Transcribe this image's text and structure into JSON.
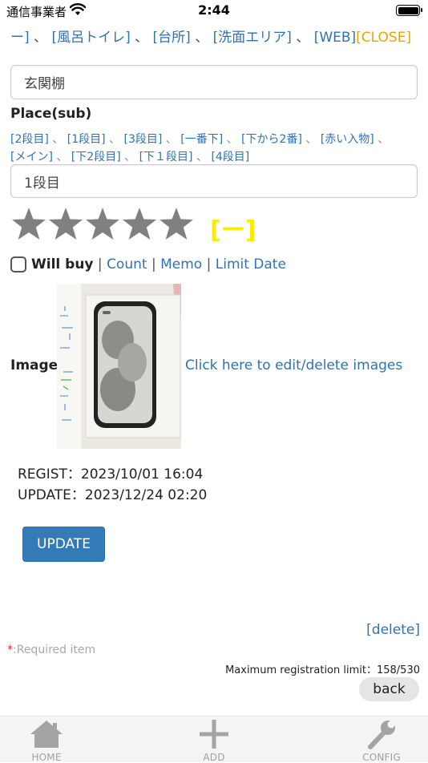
{
  "status_bar": {
    "carrier": "通信事業者",
    "time": "2:44"
  },
  "place_links": {
    "items": [
      "ー]",
      "[風呂トイレ]",
      "[台所]",
      "[洗面エリア]",
      "[WEB]"
    ],
    "separator": "、",
    "close": "[CLOSE]"
  },
  "place_field": {
    "value": "玄関棚"
  },
  "place_sub": {
    "label": "Place(sub)",
    "separator": "、",
    "row1": [
      "[2段目]",
      "[1段目]",
      "[3段目]",
      "[一番下]",
      "[下から2番]",
      "[赤い入物]"
    ],
    "row2": [
      "[メイン]",
      "[下2段目]",
      "[下１段目]",
      "[4段目]"
    ],
    "value": "1段目"
  },
  "rating": {
    "stars": 5,
    "max": 5,
    "star_color": "#808080",
    "clear_label": "[ー]",
    "clear_color": "#ffeb00"
  },
  "flags": {
    "will_buy": {
      "label": "Will buy",
      "checked": false
    },
    "separator": "|",
    "links": [
      "Count",
      "Memo",
      "Limit Date"
    ]
  },
  "image": {
    "label": "Image",
    "edit_link": "Click here to edit/delete images"
  },
  "meta": {
    "regist": "REGIST：2023/10/01 16:04",
    "update": "UPDATE：2023/12/24 02:20"
  },
  "actions": {
    "update": "UPDATE",
    "delete": "[delete]",
    "back": "back"
  },
  "footer": {
    "required_mark": "*",
    "required_text": ":Required item",
    "limit": "Maximum registration limit：158/530"
  },
  "tabbar": {
    "tabs": [
      {
        "label": "HOME",
        "icon": "home-icon"
      },
      {
        "label": "ADD",
        "icon": "plus-icon"
      },
      {
        "label": "CONFIG",
        "icon": "wrench-icon"
      }
    ]
  },
  "colors": {
    "link": "#2f72b3",
    "close": "#f0a300",
    "primary_button": "#337ab7"
  }
}
